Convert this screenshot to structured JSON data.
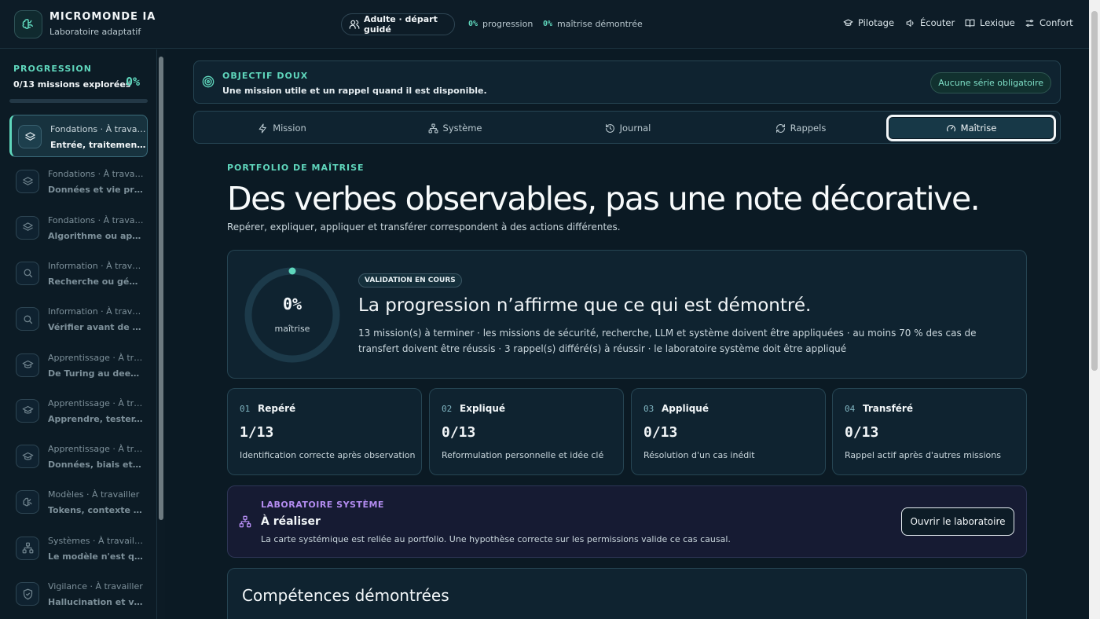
{
  "header": {
    "brand_title": "MICROMONDE IA",
    "brand_subtitle": "Laboratoire adaptatif",
    "mode_label": "Adulte · départ guidé",
    "progress_value": "0%",
    "progress_label": "progression",
    "mastery_value": "0%",
    "mastery_label": "maîtrise démontrée",
    "nav": [
      {
        "label": "Pilotage",
        "icon": "graduation-cap-icon"
      },
      {
        "label": "Écouter",
        "icon": "speaker-icon"
      },
      {
        "label": "Lexique",
        "icon": "book-icon"
      },
      {
        "label": "Confort",
        "icon": "sliders-icon"
      }
    ]
  },
  "sidebar": {
    "heading": "PROGRESSION",
    "count": "0/13 missions explorées",
    "percent": "0%",
    "progress_fraction": 0.0,
    "missions": [
      {
        "category": "Fondations · À travailler",
        "title": "Entrée, traitement, sortie",
        "icon": "layers-icon",
        "active": true
      },
      {
        "category": "Fondations · À travailler",
        "title": "Données et vie privée",
        "icon": "layers-icon",
        "active": false
      },
      {
        "category": "Fondations · À travailler",
        "title": "Algorithme ou apprentissage",
        "icon": "layers-icon",
        "active": false
      },
      {
        "category": "Information · À travailler",
        "title": "Recherche ou génération",
        "icon": "search-icon",
        "active": false
      },
      {
        "category": "Information · À travailler",
        "title": "Vérifier avant de partager",
        "icon": "search-icon",
        "active": false
      },
      {
        "category": "Apprentissage · À travailler",
        "title": "De Turing au deep learning",
        "icon": "graduation-cap-icon",
        "active": false
      },
      {
        "category": "Apprentissage · À travailler",
        "title": "Apprendre, tester, utiliser",
        "icon": "graduation-cap-icon",
        "active": false
      },
      {
        "category": "Apprentissage · À travailler",
        "title": "Données, biais et contexte",
        "icon": "graduation-cap-icon",
        "active": false
      },
      {
        "category": "Modèles · À travailler",
        "title": "Tokens, contexte et probabilités",
        "icon": "brain-icon",
        "active": false
      },
      {
        "category": "Systèmes · À travailler",
        "title": "Le modèle n'est qu'un composant",
        "icon": "network-icon",
        "active": false
      },
      {
        "category": "Vigilance · À travailler",
        "title": "Hallucination et vérification",
        "icon": "shield-icon",
        "active": false
      }
    ]
  },
  "goal": {
    "title": "OBJECTIF DOUX",
    "text": "Une mission utile et un rappel quand il est disponible.",
    "badge": "Aucune série obligatoire"
  },
  "tabs": [
    {
      "label": "Mission",
      "icon": "bolt-icon",
      "active": false
    },
    {
      "label": "Système",
      "icon": "network-icon",
      "active": false
    },
    {
      "label": "Journal",
      "icon": "history-icon",
      "active": false
    },
    {
      "label": "Rappels",
      "icon": "refresh-icon",
      "active": false
    },
    {
      "label": "Maîtrise",
      "icon": "gauge-icon",
      "active": true
    }
  ],
  "portfolio": {
    "eyebrow": "PORTFOLIO DE MAÎTRISE",
    "title": "Des verbes observables, pas une note décorative.",
    "subtitle": "Repérer, expliquer, appliquer et transférer correspondent à des actions différentes."
  },
  "validation": {
    "gauge_value": "0%",
    "gauge_label": "maîtrise",
    "gauge_fraction": 0.0,
    "badge": "VALIDATION EN COURS",
    "title": "La progression n’affirme que ce qui est démontré.",
    "text": "13 mission(s) à terminer · les missions de sécurité, recherche, LLM et système doivent être appliquées · au moins 70 % des cas de transfert doivent être réussis · 3 rappel(s) différé(s) à réussir · le laboratoire système doit être appliqué"
  },
  "levels": [
    {
      "num": "01",
      "name": "Repéré",
      "value": "1/13",
      "desc": "Identification correcte après observation"
    },
    {
      "num": "02",
      "name": "Expliqué",
      "value": "0/13",
      "desc": "Reformulation personnelle et idée clé"
    },
    {
      "num": "03",
      "name": "Appliqué",
      "value": "0/13",
      "desc": "Résolution d'un cas inédit"
    },
    {
      "num": "04",
      "name": "Transféré",
      "value": "0/13",
      "desc": "Rappel actif après d'autres missions"
    }
  ],
  "lab": {
    "eyebrow": "LABORATOIRE SYSTÈME",
    "title": "À réaliser",
    "text": "La carte systémique est reliée au portfolio. Une hypothèse correcte sur les permissions valide ce cas causal.",
    "button": "Ouvrir le laboratoire"
  },
  "competences": {
    "title": "Compétences démontrées"
  },
  "colors": {
    "accent": "#5fd6bc",
    "purple": "#b38cf0",
    "background": "#0b1a24"
  }
}
